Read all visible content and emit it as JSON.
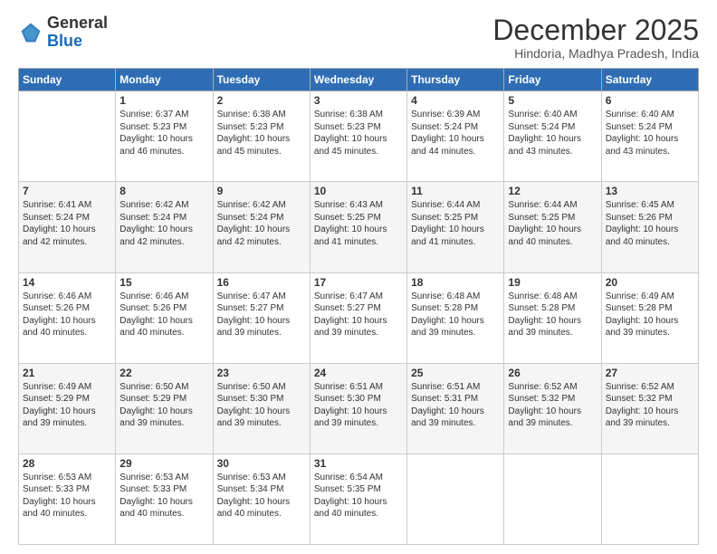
{
  "logo": {
    "general": "General",
    "blue": "Blue"
  },
  "header": {
    "title": "December 2025",
    "subtitle": "Hindoria, Madhya Pradesh, India"
  },
  "weekdays": [
    "Sunday",
    "Monday",
    "Tuesday",
    "Wednesday",
    "Thursday",
    "Friday",
    "Saturday"
  ],
  "weeks": [
    [
      {
        "day": "",
        "sunrise": "",
        "sunset": "",
        "daylight": ""
      },
      {
        "day": "1",
        "sunrise": "Sunrise: 6:37 AM",
        "sunset": "Sunset: 5:23 PM",
        "daylight": "Daylight: 10 hours and 46 minutes."
      },
      {
        "day": "2",
        "sunrise": "Sunrise: 6:38 AM",
        "sunset": "Sunset: 5:23 PM",
        "daylight": "Daylight: 10 hours and 45 minutes."
      },
      {
        "day": "3",
        "sunrise": "Sunrise: 6:38 AM",
        "sunset": "Sunset: 5:23 PM",
        "daylight": "Daylight: 10 hours and 45 minutes."
      },
      {
        "day": "4",
        "sunrise": "Sunrise: 6:39 AM",
        "sunset": "Sunset: 5:24 PM",
        "daylight": "Daylight: 10 hours and 44 minutes."
      },
      {
        "day": "5",
        "sunrise": "Sunrise: 6:40 AM",
        "sunset": "Sunset: 5:24 PM",
        "daylight": "Daylight: 10 hours and 43 minutes."
      },
      {
        "day": "6",
        "sunrise": "Sunrise: 6:40 AM",
        "sunset": "Sunset: 5:24 PM",
        "daylight": "Daylight: 10 hours and 43 minutes."
      }
    ],
    [
      {
        "day": "7",
        "sunrise": "Sunrise: 6:41 AM",
        "sunset": "Sunset: 5:24 PM",
        "daylight": "Daylight: 10 hours and 42 minutes."
      },
      {
        "day": "8",
        "sunrise": "Sunrise: 6:42 AM",
        "sunset": "Sunset: 5:24 PM",
        "daylight": "Daylight: 10 hours and 42 minutes."
      },
      {
        "day": "9",
        "sunrise": "Sunrise: 6:42 AM",
        "sunset": "Sunset: 5:24 PM",
        "daylight": "Daylight: 10 hours and 42 minutes."
      },
      {
        "day": "10",
        "sunrise": "Sunrise: 6:43 AM",
        "sunset": "Sunset: 5:25 PM",
        "daylight": "Daylight: 10 hours and 41 minutes."
      },
      {
        "day": "11",
        "sunrise": "Sunrise: 6:44 AM",
        "sunset": "Sunset: 5:25 PM",
        "daylight": "Daylight: 10 hours and 41 minutes."
      },
      {
        "day": "12",
        "sunrise": "Sunrise: 6:44 AM",
        "sunset": "Sunset: 5:25 PM",
        "daylight": "Daylight: 10 hours and 40 minutes."
      },
      {
        "day": "13",
        "sunrise": "Sunrise: 6:45 AM",
        "sunset": "Sunset: 5:26 PM",
        "daylight": "Daylight: 10 hours and 40 minutes."
      }
    ],
    [
      {
        "day": "14",
        "sunrise": "Sunrise: 6:46 AM",
        "sunset": "Sunset: 5:26 PM",
        "daylight": "Daylight: 10 hours and 40 minutes."
      },
      {
        "day": "15",
        "sunrise": "Sunrise: 6:46 AM",
        "sunset": "Sunset: 5:26 PM",
        "daylight": "Daylight: 10 hours and 40 minutes."
      },
      {
        "day": "16",
        "sunrise": "Sunrise: 6:47 AM",
        "sunset": "Sunset: 5:27 PM",
        "daylight": "Daylight: 10 hours and 39 minutes."
      },
      {
        "day": "17",
        "sunrise": "Sunrise: 6:47 AM",
        "sunset": "Sunset: 5:27 PM",
        "daylight": "Daylight: 10 hours and 39 minutes."
      },
      {
        "day": "18",
        "sunrise": "Sunrise: 6:48 AM",
        "sunset": "Sunset: 5:28 PM",
        "daylight": "Daylight: 10 hours and 39 minutes."
      },
      {
        "day": "19",
        "sunrise": "Sunrise: 6:48 AM",
        "sunset": "Sunset: 5:28 PM",
        "daylight": "Daylight: 10 hours and 39 minutes."
      },
      {
        "day": "20",
        "sunrise": "Sunrise: 6:49 AM",
        "sunset": "Sunset: 5:28 PM",
        "daylight": "Daylight: 10 hours and 39 minutes."
      }
    ],
    [
      {
        "day": "21",
        "sunrise": "Sunrise: 6:49 AM",
        "sunset": "Sunset: 5:29 PM",
        "daylight": "Daylight: 10 hours and 39 minutes."
      },
      {
        "day": "22",
        "sunrise": "Sunrise: 6:50 AM",
        "sunset": "Sunset: 5:29 PM",
        "daylight": "Daylight: 10 hours and 39 minutes."
      },
      {
        "day": "23",
        "sunrise": "Sunrise: 6:50 AM",
        "sunset": "Sunset: 5:30 PM",
        "daylight": "Daylight: 10 hours and 39 minutes."
      },
      {
        "day": "24",
        "sunrise": "Sunrise: 6:51 AM",
        "sunset": "Sunset: 5:30 PM",
        "daylight": "Daylight: 10 hours and 39 minutes."
      },
      {
        "day": "25",
        "sunrise": "Sunrise: 6:51 AM",
        "sunset": "Sunset: 5:31 PM",
        "daylight": "Daylight: 10 hours and 39 minutes."
      },
      {
        "day": "26",
        "sunrise": "Sunrise: 6:52 AM",
        "sunset": "Sunset: 5:32 PM",
        "daylight": "Daylight: 10 hours and 39 minutes."
      },
      {
        "day": "27",
        "sunrise": "Sunrise: 6:52 AM",
        "sunset": "Sunset: 5:32 PM",
        "daylight": "Daylight: 10 hours and 39 minutes."
      }
    ],
    [
      {
        "day": "28",
        "sunrise": "Sunrise: 6:53 AM",
        "sunset": "Sunset: 5:33 PM",
        "daylight": "Daylight: 10 hours and 40 minutes."
      },
      {
        "day": "29",
        "sunrise": "Sunrise: 6:53 AM",
        "sunset": "Sunset: 5:33 PM",
        "daylight": "Daylight: 10 hours and 40 minutes."
      },
      {
        "day": "30",
        "sunrise": "Sunrise: 6:53 AM",
        "sunset": "Sunset: 5:34 PM",
        "daylight": "Daylight: 10 hours and 40 minutes."
      },
      {
        "day": "31",
        "sunrise": "Sunrise: 6:54 AM",
        "sunset": "Sunset: 5:35 PM",
        "daylight": "Daylight: 10 hours and 40 minutes."
      },
      {
        "day": "",
        "sunrise": "",
        "sunset": "",
        "daylight": ""
      },
      {
        "day": "",
        "sunrise": "",
        "sunset": "",
        "daylight": ""
      },
      {
        "day": "",
        "sunrise": "",
        "sunset": "",
        "daylight": ""
      }
    ]
  ]
}
